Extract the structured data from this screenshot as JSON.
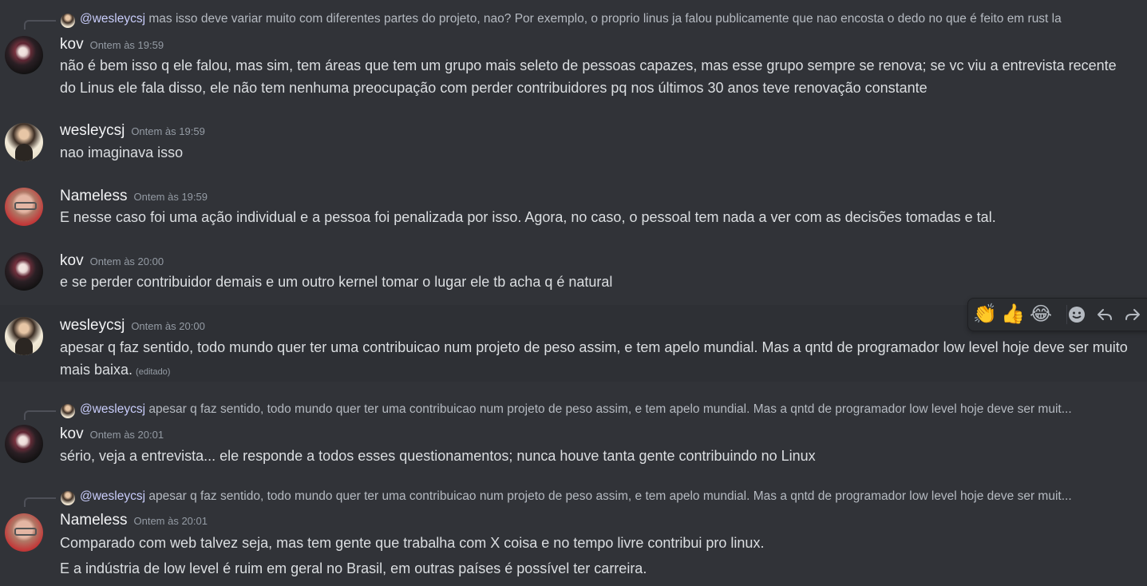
{
  "messages": [
    {
      "reply": {
        "mention": "@wesleycsj",
        "text": "mas isso deve variar muito com diferentes partes do projeto, nao? Por exemplo, o proprio linus ja falou publicamente que nao encosta o dedo no que é feito em rust la"
      },
      "author": "kov",
      "time": "Ontem às 19:59",
      "lines": [
        "não é bem isso q ele falou, mas sim, tem áreas que tem um grupo mais seleto de pessoas capazes, mas esse grupo sempre se renova; se vc viu a entrevista recente do Linus ele fala disso, ele não tem nenhuma preocupação com perder contribuidores pq nos últimos 30 anos teve renovação constante"
      ]
    },
    {
      "author": "wesleycsj",
      "time": "Ontem às 19:59",
      "lines": [
        "nao imaginava isso"
      ]
    },
    {
      "author": "Nameless",
      "time": "Ontem às 19:59",
      "lines": [
        "E nesse caso foi uma ação individual e a pessoa foi penalizada por isso. Agora, no caso, o pessoal tem nada a ver com as decisões tomadas e tal."
      ]
    },
    {
      "author": "kov",
      "time": "Ontem às 20:00",
      "lines": [
        "e se perder contribuidor demais e um outro kernel tomar o lugar ele tb acha q é natural"
      ]
    },
    {
      "author": "wesleycsj",
      "time": "Ontem às 20:00",
      "lines": [
        "apesar q faz sentido, todo mundo quer ter uma contribuicao num projeto de peso assim, e tem apelo mundial. Mas a qntd de programador low level hoje deve ser muito mais baixa."
      ],
      "edited": "(editado)"
    },
    {
      "reply": {
        "mention": "@wesleycsj",
        "text": "apesar q faz sentido, todo mundo quer ter uma contribuicao num projeto de peso assim, e tem apelo mundial. Mas a qntd de programador low level hoje deve ser muit..."
      },
      "author": "kov",
      "time": "Ontem às 20:01",
      "lines": [
        "sério, veja a entrevista... ele responde a todos esses questionamentos; nunca houve tanta gente contribuindo no Linux"
      ]
    },
    {
      "reply": {
        "mention": "@wesleycsj",
        "text": "apesar q faz sentido, todo mundo quer ter uma contribuicao num projeto de peso assim, e tem apelo mundial. Mas a qntd de programador low level hoje deve ser muit..."
      },
      "author": "Nameless",
      "time": "Ontem às 20:01",
      "lines": [
        "Comparado com web talvez seja, mas tem gente que trabalha com X coisa e no tempo livre contribui pro linux.",
        "E a indústria de low level é ruim em geral no Brasil, em outras países é possível ter carreira."
      ]
    }
  ],
  "toolbar": {
    "reactions": [
      "👏",
      "👍",
      "😂"
    ],
    "icons": [
      "add-reaction-icon",
      "reply-icon",
      "forward-icon"
    ]
  }
}
